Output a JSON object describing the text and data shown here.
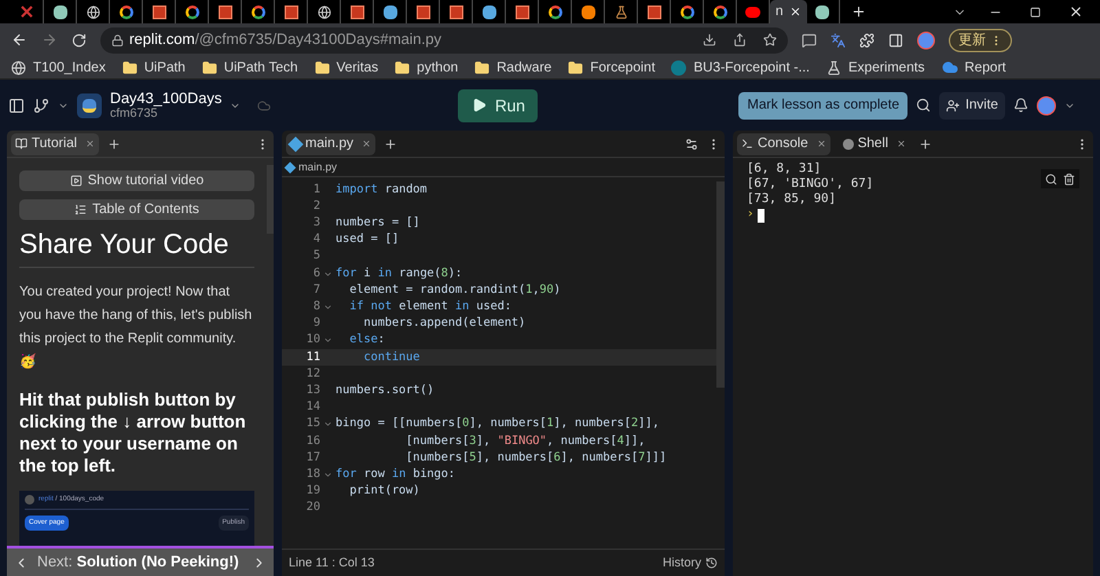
{
  "browser": {
    "tabs": [
      {
        "kind": "x",
        "selected": false
      },
      {
        "kind": "teal",
        "selected": false
      },
      {
        "kind": "globe",
        "selected": false
      },
      {
        "kind": "google",
        "selected": false
      },
      {
        "kind": "uipath",
        "selected": false
      },
      {
        "kind": "google",
        "selected": false
      },
      {
        "kind": "uipath",
        "selected": false
      },
      {
        "kind": "google",
        "selected": false
      },
      {
        "kind": "uipath",
        "selected": false
      },
      {
        "kind": "globe",
        "selected": false
      },
      {
        "kind": "uipath",
        "selected": false
      },
      {
        "kind": "blue",
        "selected": false
      },
      {
        "kind": "uipath",
        "selected": false
      },
      {
        "kind": "uipath",
        "selected": false
      },
      {
        "kind": "blue",
        "selected": false
      },
      {
        "kind": "uipath",
        "selected": false
      },
      {
        "kind": "google",
        "selected": false
      },
      {
        "kind": "orange",
        "selected": false
      },
      {
        "kind": "flask",
        "selected": false
      },
      {
        "kind": "uipath",
        "selected": false
      },
      {
        "kind": "google",
        "selected": false
      },
      {
        "kind": "google",
        "selected": false
      },
      {
        "kind": "youtube",
        "selected": false
      },
      {
        "kind": "text",
        "title": "n",
        "selected": true
      },
      {
        "kind": "teal",
        "selected": false
      }
    ],
    "url_host": "replit.com",
    "url_path": "/@cfm6735/Day43100Days#main.py",
    "update_button": "更新",
    "bookmarks": [
      {
        "kind": "globe",
        "label": "T100_Index"
      },
      {
        "kind": "folder",
        "label": "UiPath"
      },
      {
        "kind": "folder",
        "label": "UiPath Tech"
      },
      {
        "kind": "folder",
        "label": "Veritas"
      },
      {
        "kind": "folder",
        "label": "python"
      },
      {
        "kind": "folder",
        "label": "Radware"
      },
      {
        "kind": "folder",
        "label": "Forcepoint"
      },
      {
        "kind": "sharepoint",
        "label": "BU3-Forcepoint -..."
      },
      {
        "kind": "flask",
        "label": "Experiments"
      },
      {
        "kind": "cloud",
        "label": "Report"
      }
    ]
  },
  "header": {
    "repl_name": "Day43_100Days",
    "owner": "cfm6735",
    "run_button": "Run",
    "mark_complete_button": "Mark lesson as complete",
    "invite_button": "Invite"
  },
  "tutorial": {
    "tab": "Tutorial",
    "video_button": "Show tutorial video",
    "toc_button": "Table of Contents",
    "title": "Share Your Code",
    "paragraph": "You created your project! Now that you have the hang of this, let's publish this project to the Replit community. 🥳",
    "instruction": "Hit that publish button by clicking the ↓ arrow button next to your username on the top left.",
    "embedded": {
      "breadcrumb_brand": "replit",
      "breadcrumb_rest": "/ 100days_code",
      "cover_button": "Cover page",
      "publish_button": "Publish"
    },
    "next_prefix": "Next:",
    "next_title": "Solution (No Peeking!)"
  },
  "editor": {
    "tab": "main.py",
    "breadcrumb": "main.py",
    "lines": [
      {
        "n": "1",
        "foldable": false,
        "current": false,
        "tokens": [
          {
            "text": "import",
            "kind": "kw"
          },
          {
            "text": " random",
            "kind": "id"
          }
        ]
      },
      {
        "n": "2",
        "foldable": false,
        "current": false
      },
      {
        "n": "3",
        "foldable": false,
        "current": false,
        "tokens": [
          {
            "text": "numbers = []",
            "kind": "id"
          }
        ]
      },
      {
        "n": "4",
        "foldable": false,
        "current": false,
        "tokens": [
          {
            "text": "used = []",
            "kind": "id"
          }
        ]
      },
      {
        "n": "5",
        "foldable": false,
        "current": false
      },
      {
        "n": "6",
        "foldable": true,
        "current": false,
        "tokens": [
          {
            "text": "for",
            "kind": "kw"
          },
          {
            "text": " i ",
            "kind": "id"
          },
          {
            "text": "in",
            "kind": "kw"
          },
          {
            "text": " range(",
            "kind": "id"
          },
          {
            "text": "8",
            "kind": "num"
          },
          {
            "text": "):",
            "kind": "id"
          }
        ]
      },
      {
        "n": "7",
        "foldable": false,
        "current": false,
        "tokens": [
          {
            "text": "  element = random.randint(",
            "kind": "id"
          },
          {
            "text": "1",
            "kind": "num"
          },
          {
            "text": ",",
            "kind": "id"
          },
          {
            "text": "90",
            "kind": "num"
          },
          {
            "text": ")",
            "kind": "id"
          }
        ]
      },
      {
        "n": "8",
        "foldable": true,
        "current": false,
        "tokens": [
          {
            "text": "  if not",
            "kind": "kw"
          },
          {
            "text": " element ",
            "kind": "id"
          },
          {
            "text": "in",
            "kind": "kw"
          },
          {
            "text": " used:",
            "kind": "id"
          }
        ]
      },
      {
        "n": "9",
        "foldable": false,
        "current": false,
        "tokens": [
          {
            "text": "    numbers.append(element)",
            "kind": "id"
          }
        ]
      },
      {
        "n": "10",
        "foldable": true,
        "current": false,
        "tokens": [
          {
            "text": "  else",
            "kind": "kw"
          },
          {
            "text": ":",
            "kind": "id"
          }
        ]
      },
      {
        "n": "11",
        "foldable": false,
        "current": true,
        "tokens": [
          {
            "text": "    continue",
            "kind": "kw"
          }
        ]
      },
      {
        "n": "12",
        "foldable": false,
        "current": false
      },
      {
        "n": "13",
        "foldable": false,
        "current": false,
        "tokens": [
          {
            "text": "numbers.sort()",
            "kind": "id"
          }
        ]
      },
      {
        "n": "14",
        "foldable": false,
        "current": false
      },
      {
        "n": "15",
        "foldable": true,
        "current": false,
        "tokens": [
          {
            "text": "bingo = [[numbers[",
            "kind": "id"
          },
          {
            "text": "0",
            "kind": "num"
          },
          {
            "text": "], numbers[",
            "kind": "id"
          },
          {
            "text": "1",
            "kind": "num"
          },
          {
            "text": "], numbers[",
            "kind": "id"
          },
          {
            "text": "2",
            "kind": "num"
          },
          {
            "text": "]],",
            "kind": "id"
          }
        ]
      },
      {
        "n": "16",
        "foldable": false,
        "current": false,
        "tokens": [
          {
            "text": "          [numbers[",
            "kind": "id"
          },
          {
            "text": "3",
            "kind": "num"
          },
          {
            "text": "], ",
            "kind": "id"
          },
          {
            "text": "\"BINGO\"",
            "kind": "str"
          },
          {
            "text": ", numbers[",
            "kind": "id"
          },
          {
            "text": "4",
            "kind": "num"
          },
          {
            "text": "]],",
            "kind": "id"
          }
        ]
      },
      {
        "n": "17",
        "foldable": false,
        "current": false,
        "tokens": [
          {
            "text": "          [numbers[",
            "kind": "id"
          },
          {
            "text": "5",
            "kind": "num"
          },
          {
            "text": "], numbers[",
            "kind": "id"
          },
          {
            "text": "6",
            "kind": "num"
          },
          {
            "text": "], numbers[",
            "kind": "id"
          },
          {
            "text": "7",
            "kind": "num"
          },
          {
            "text": "]]]",
            "kind": "id"
          }
        ]
      },
      {
        "n": "18",
        "foldable": true,
        "current": false,
        "tokens": [
          {
            "text": "for",
            "kind": "kw"
          },
          {
            "text": " row ",
            "kind": "id"
          },
          {
            "text": "in",
            "kind": "kw"
          },
          {
            "text": " bingo:",
            "kind": "id"
          }
        ]
      },
      {
        "n": "19",
        "foldable": false,
        "current": false,
        "tokens": [
          {
            "text": "  print(row)",
            "kind": "id"
          }
        ]
      },
      {
        "n": "20",
        "foldable": false,
        "current": false
      }
    ],
    "status": "Line 11 : Col 13",
    "history": "History"
  },
  "console": {
    "tabs": [
      {
        "label": "Console",
        "kind": "console",
        "selected": true
      },
      {
        "label": "Shell",
        "kind": "shell",
        "selected": false
      }
    ],
    "output": [
      "[6, 8, 31]",
      "[67, 'BINGO', 67]",
      "[73, 85, 90]"
    ],
    "prompt": "›"
  }
}
